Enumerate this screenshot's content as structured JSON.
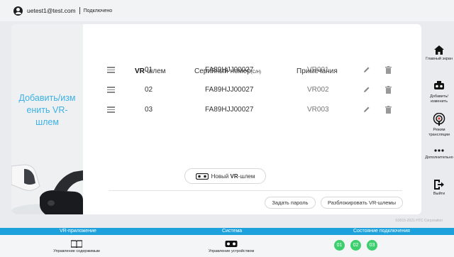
{
  "header": {
    "email": "uetest1@test.com",
    "status": "Подключено"
  },
  "sidebar_left": {
    "add_label_lines": [
      "Добавить/изм",
      "енить VR-",
      "шлем"
    ]
  },
  "table": {
    "headers": {
      "vr_bold": "VR",
      "vr_rest": "-шлем",
      "serial": "Серийный номер",
      "serial_small": "(С/Н)",
      "notes": "Примечания"
    },
    "rows": [
      {
        "num": "01",
        "serial": "FA89HJJ00027",
        "note": "VR001"
      },
      {
        "num": "02",
        "serial": "FA89HJJ00027",
        "note": "VR002"
      },
      {
        "num": "03",
        "serial": "FA89HJJ00027",
        "note": "VR003"
      }
    ]
  },
  "buttons": {
    "new_prefix": "Новый ",
    "new_bold": "VR",
    "new_suffix": "-шлем",
    "set_password": "Задать пароль",
    "unlock": "Разблокировать VR-шлемы"
  },
  "copyright": "©2015-2021 HTC Corporation",
  "right_nav": {
    "home": "Главный экран",
    "edit": "Добавить/ изменить",
    "broadcast": "Режим трансляции",
    "more": "Дополнительно",
    "exit": "Выйти"
  },
  "bottom": {
    "section_vr_app": "VR-приложение",
    "section_system": "Система",
    "section_connection": "Состояние подключения",
    "content_mgmt": "Управление содержимым",
    "device_mgmt": "Управление устройством",
    "dots": [
      "01",
      "02",
      "03"
    ]
  },
  "colors": {
    "accent": "#1da1dc",
    "link_text": "#3db1e4",
    "connected": "#3dcf6e"
  }
}
